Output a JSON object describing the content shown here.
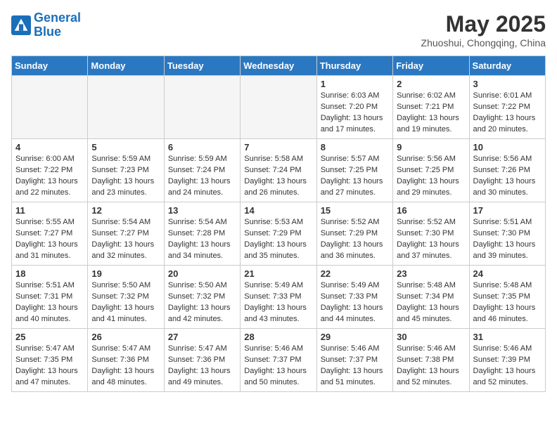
{
  "header": {
    "logo_general": "General",
    "logo_blue": "Blue",
    "month": "May 2025",
    "location": "Zhuoshui, Chongqing, China"
  },
  "weekdays": [
    "Sunday",
    "Monday",
    "Tuesday",
    "Wednesday",
    "Thursday",
    "Friday",
    "Saturday"
  ],
  "weeks": [
    [
      {
        "day": "",
        "info": "",
        "empty": true
      },
      {
        "day": "",
        "info": "",
        "empty": true
      },
      {
        "day": "",
        "info": "",
        "empty": true
      },
      {
        "day": "",
        "info": "",
        "empty": true
      },
      {
        "day": "1",
        "info": "Sunrise: 6:03 AM\nSunset: 7:20 PM\nDaylight: 13 hours\nand 17 minutes."
      },
      {
        "day": "2",
        "info": "Sunrise: 6:02 AM\nSunset: 7:21 PM\nDaylight: 13 hours\nand 19 minutes."
      },
      {
        "day": "3",
        "info": "Sunrise: 6:01 AM\nSunset: 7:22 PM\nDaylight: 13 hours\nand 20 minutes."
      }
    ],
    [
      {
        "day": "4",
        "info": "Sunrise: 6:00 AM\nSunset: 7:22 PM\nDaylight: 13 hours\nand 22 minutes."
      },
      {
        "day": "5",
        "info": "Sunrise: 5:59 AM\nSunset: 7:23 PM\nDaylight: 13 hours\nand 23 minutes."
      },
      {
        "day": "6",
        "info": "Sunrise: 5:59 AM\nSunset: 7:24 PM\nDaylight: 13 hours\nand 24 minutes."
      },
      {
        "day": "7",
        "info": "Sunrise: 5:58 AM\nSunset: 7:24 PM\nDaylight: 13 hours\nand 26 minutes."
      },
      {
        "day": "8",
        "info": "Sunrise: 5:57 AM\nSunset: 7:25 PM\nDaylight: 13 hours\nand 27 minutes."
      },
      {
        "day": "9",
        "info": "Sunrise: 5:56 AM\nSunset: 7:25 PM\nDaylight: 13 hours\nand 29 minutes."
      },
      {
        "day": "10",
        "info": "Sunrise: 5:56 AM\nSunset: 7:26 PM\nDaylight: 13 hours\nand 30 minutes."
      }
    ],
    [
      {
        "day": "11",
        "info": "Sunrise: 5:55 AM\nSunset: 7:27 PM\nDaylight: 13 hours\nand 31 minutes."
      },
      {
        "day": "12",
        "info": "Sunrise: 5:54 AM\nSunset: 7:27 PM\nDaylight: 13 hours\nand 32 minutes."
      },
      {
        "day": "13",
        "info": "Sunrise: 5:54 AM\nSunset: 7:28 PM\nDaylight: 13 hours\nand 34 minutes."
      },
      {
        "day": "14",
        "info": "Sunrise: 5:53 AM\nSunset: 7:29 PM\nDaylight: 13 hours\nand 35 minutes."
      },
      {
        "day": "15",
        "info": "Sunrise: 5:52 AM\nSunset: 7:29 PM\nDaylight: 13 hours\nand 36 minutes."
      },
      {
        "day": "16",
        "info": "Sunrise: 5:52 AM\nSunset: 7:30 PM\nDaylight: 13 hours\nand 37 minutes."
      },
      {
        "day": "17",
        "info": "Sunrise: 5:51 AM\nSunset: 7:30 PM\nDaylight: 13 hours\nand 39 minutes."
      }
    ],
    [
      {
        "day": "18",
        "info": "Sunrise: 5:51 AM\nSunset: 7:31 PM\nDaylight: 13 hours\nand 40 minutes."
      },
      {
        "day": "19",
        "info": "Sunrise: 5:50 AM\nSunset: 7:32 PM\nDaylight: 13 hours\nand 41 minutes."
      },
      {
        "day": "20",
        "info": "Sunrise: 5:50 AM\nSunset: 7:32 PM\nDaylight: 13 hours\nand 42 minutes."
      },
      {
        "day": "21",
        "info": "Sunrise: 5:49 AM\nSunset: 7:33 PM\nDaylight: 13 hours\nand 43 minutes."
      },
      {
        "day": "22",
        "info": "Sunrise: 5:49 AM\nSunset: 7:33 PM\nDaylight: 13 hours\nand 44 minutes."
      },
      {
        "day": "23",
        "info": "Sunrise: 5:48 AM\nSunset: 7:34 PM\nDaylight: 13 hours\nand 45 minutes."
      },
      {
        "day": "24",
        "info": "Sunrise: 5:48 AM\nSunset: 7:35 PM\nDaylight: 13 hours\nand 46 minutes."
      }
    ],
    [
      {
        "day": "25",
        "info": "Sunrise: 5:47 AM\nSunset: 7:35 PM\nDaylight: 13 hours\nand 47 minutes."
      },
      {
        "day": "26",
        "info": "Sunrise: 5:47 AM\nSunset: 7:36 PM\nDaylight: 13 hours\nand 48 minutes."
      },
      {
        "day": "27",
        "info": "Sunrise: 5:47 AM\nSunset: 7:36 PM\nDaylight: 13 hours\nand 49 minutes."
      },
      {
        "day": "28",
        "info": "Sunrise: 5:46 AM\nSunset: 7:37 PM\nDaylight: 13 hours\nand 50 minutes."
      },
      {
        "day": "29",
        "info": "Sunrise: 5:46 AM\nSunset: 7:37 PM\nDaylight: 13 hours\nand 51 minutes."
      },
      {
        "day": "30",
        "info": "Sunrise: 5:46 AM\nSunset: 7:38 PM\nDaylight: 13 hours\nand 52 minutes."
      },
      {
        "day": "31",
        "info": "Sunrise: 5:46 AM\nSunset: 7:39 PM\nDaylight: 13 hours\nand 52 minutes."
      }
    ]
  ]
}
